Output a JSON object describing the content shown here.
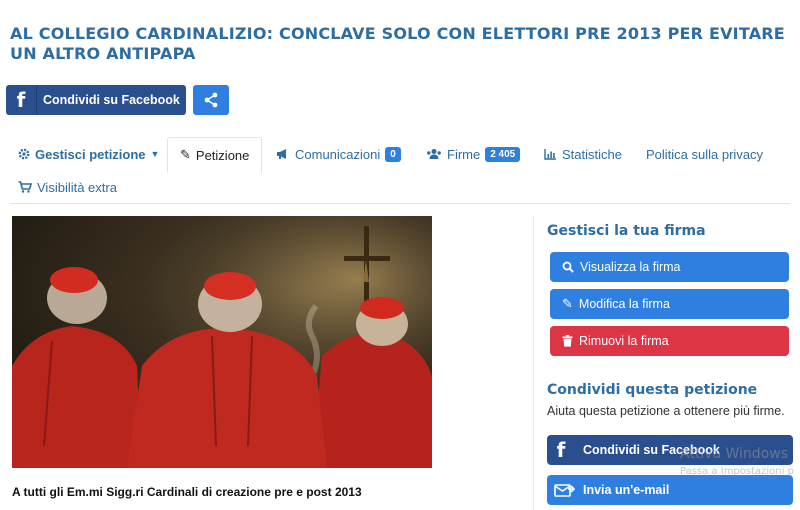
{
  "title": "AL COLLEGIO CARDINALIZIO: CONCLAVE SOLO CON ELETTORI PRE 2013 PER EVITARE UN ALTRO ANTIPAPA",
  "share_bar": {
    "facebook_label": "Condividi su Facebook",
    "facebook_icon": "facebook-icon",
    "share_icon": "share-icon"
  },
  "tabs": [
    {
      "label": "Gestisci petizione",
      "icon": "gear-icon"
    },
    {
      "label": "Petizione",
      "icon": "pencil-icon"
    },
    {
      "label": "Comunicazioni",
      "icon": "megaphone-icon",
      "badge": "0"
    },
    {
      "label": "Firme",
      "icon": "users-icon",
      "badge": "2 405"
    },
    {
      "label": "Statistiche",
      "icon": "bar-chart-icon"
    },
    {
      "label": "Politica sulla privacy"
    },
    {
      "label": "Visibilità extra",
      "icon": "cart-icon"
    }
  ],
  "main": {
    "image_alt": "Cardinali in preghiera",
    "caption": "A tutti gli Em.mi Sigg.ri Cardinali di creazione pre e post 2013"
  },
  "sidebar": {
    "manage_title": "Gestisci la tua firma",
    "view_label": "Visualizza la firma",
    "edit_label": "Modifica la firma",
    "remove_label": "Rimuovi la firma",
    "share_title": "Condividi questa petizione",
    "share_text": "Aiuta questa petizione a ottenere più firme.",
    "facebook_label": "Condividi su Facebook",
    "email_label": "Invia un'e-mail"
  },
  "watermark": {
    "line1": "Attiva Windows",
    "line2": "Passa a Impostazioni p"
  },
  "colors": {
    "title": "#2d6da3",
    "facebook": "#2a4f8f",
    "primary": "#2f7fe0",
    "danger": "#dc3545"
  }
}
